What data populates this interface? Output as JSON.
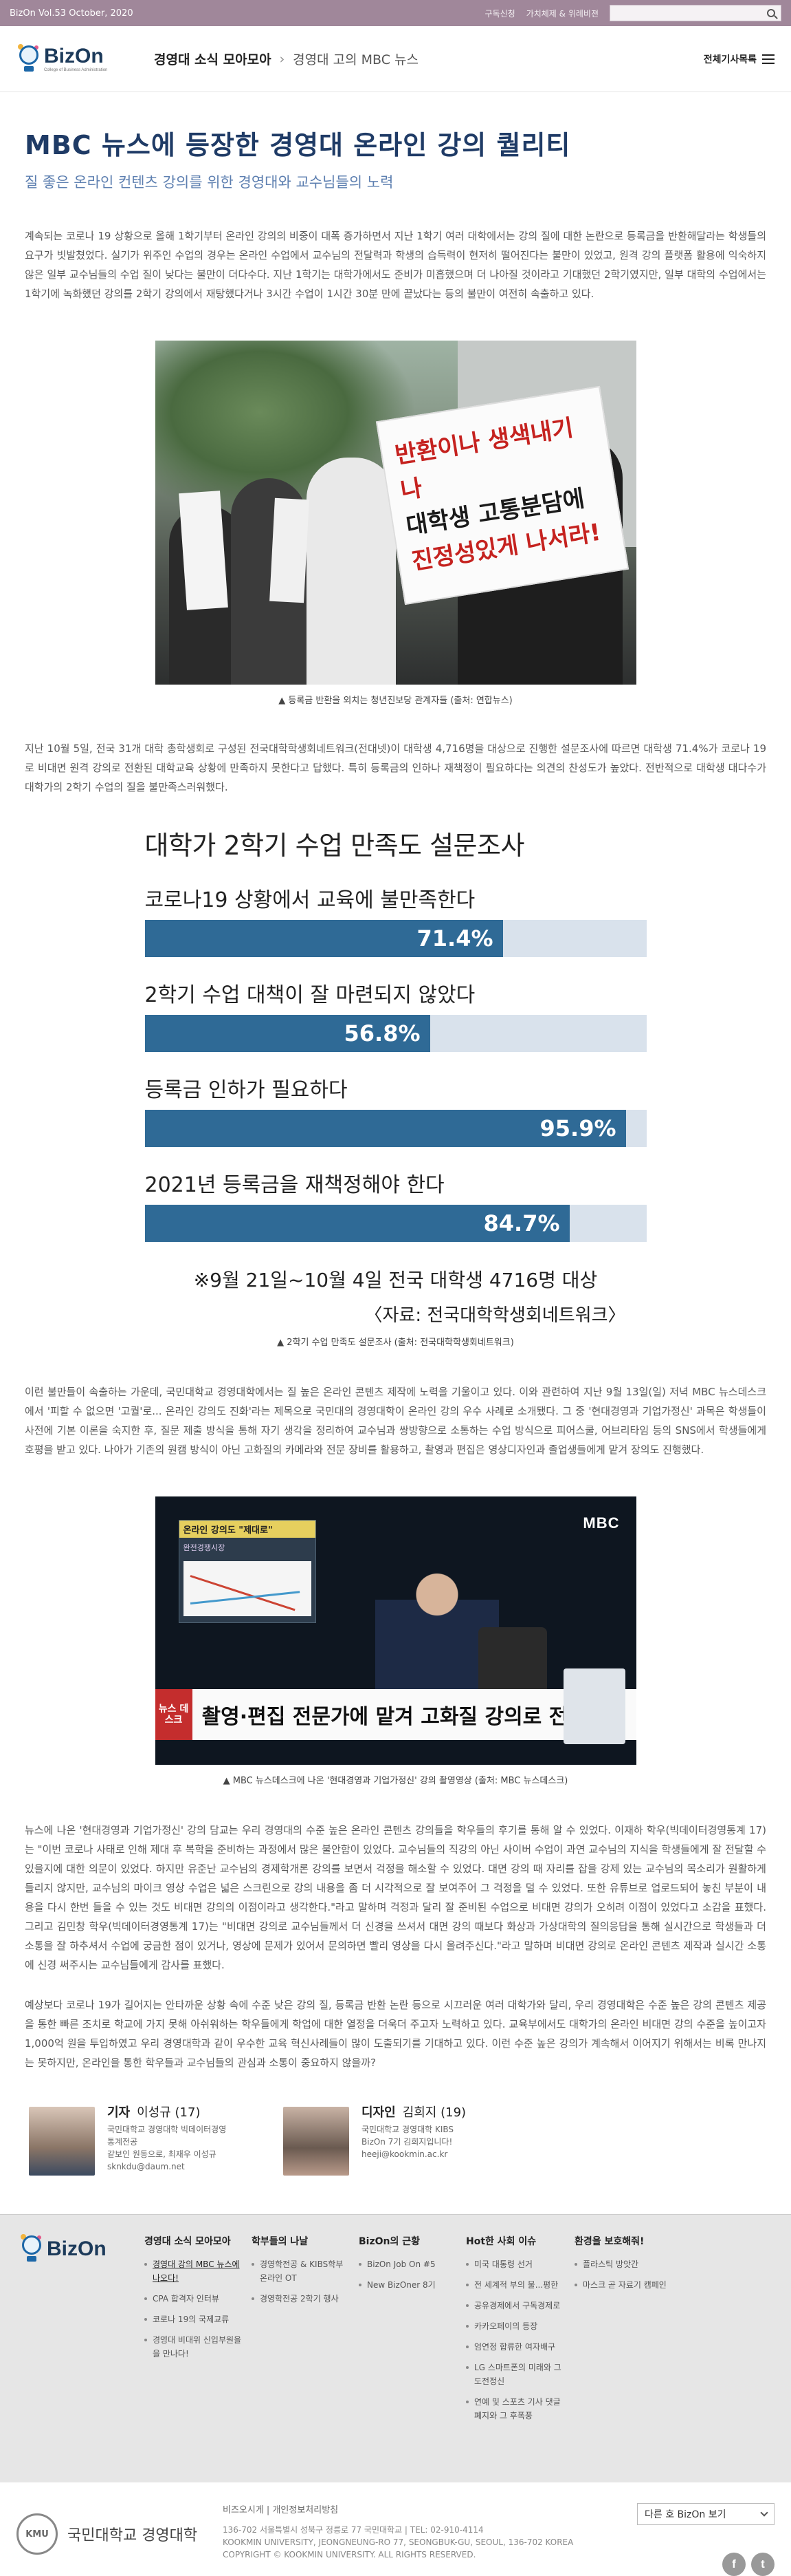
{
  "topbar": {
    "issue": "BizOn Vol.53   October, 2020",
    "links": [
      "구독신청",
      "가치체제 & 위례비젼"
    ]
  },
  "header": {
    "logo": "BizOn",
    "logo_tagline": "College of Business Administration",
    "breadcrumb": {
      "category": "경영대 소식 모아모아",
      "current": "경영대 고의 MBC 뉴스"
    },
    "menu_label": "전체기사목록"
  },
  "article": {
    "title": "MBC 뉴스에 등장한 경영대 온라인 강의 퀄리티",
    "subtitle": "질 좋은 온라인 컨텐츠 강의를 위한 경영대와 교수님들의 노력",
    "p1": "계속되는 코로나 19 상황으로 올해 1학기부터 온라인 강의의 비중이 대폭 증가하면서 지난 1학기 여러 대학에서는 강의 질에 대한 논란으로 등록금을 반환해달라는 학생들의 요구가 빗발쳤었다. 실기가 위주인 수업의 경우는 온라인 수업에서 교수님의 전달력과 학생의 습득력이 현저히 떨어진다는 불만이 있었고, 원격 강의 플랫폼 활용에 익숙하지 않은 일부 교수님들의 수업 질이 낮다는 불만이 더다수다. 지난 1학기는 대학가에서도 준비가 미흡했으며 더 나아질 것이라고 기대했던 2학기였지만, 일부 대학의 수업에서는 1학기에 녹화했던 강의를 2학기 강의에서 재탕했다거나 3시간 수업이 1시간 30분 만에 끝났다는 등의 불만이 여전히 속출하고 있다.",
    "photo_caption": "▲ 등록금 반환을 외치는 청년진보당 관계자들 (출처: 연합뉴스)",
    "sign_text": [
      "반환이나 생색내기나",
      "대학생 고통분담에",
      "진정성있게 나서라!"
    ],
    "p2": "지난 10월 5일, 전국 31개 대학 총학생회로 구성된 전국대학학생회네트워크(전대넷)이 대학생 4,716명을 대상으로 진행한 설문조사에 따르면 대학생 71.4%가 코로나 19로 비대면 원격 강의로 전환된 대학교육 상황에 만족하지 못한다고 답했다. 특히 등록금의 인하나 재책정이 필요하다는 의견의 찬성도가 높았다. 전반적으로 대학생 대다수가 대학가의 2학기 수업의 질을 불만족스러워했다.",
    "survey_caption": "▲ 2학기 수업 만족도 설문조사 (출처: 전국대학학생회네트워크)",
    "p3": "이런 불만들이 속출하는 가운데, 국민대학교 경영대학에서는 질 높은 온라인 콘텐츠 제작에 노력을 기울이고 있다. 이와 관련하여 지난 9월 13일(일) 저녁 MBC 뉴스데스크에서 '피할 수 없으면 '고퀄'로... 온라인 강의도 진화'라는 제목으로 국민대의 경영대학이 온라인 강의 우수 사례로 소개됐다. 그 중 '현대경영과 기업가정신' 과목은 학생들이 사전에 기본 이론을 숙지한 후, 질문 제출 방식을 통해 자기 생각을 정리하여 교수님과 쌍방향으로 소통하는 수업 방식으로 피어스쿨, 어브리타임 등의 SNS에서 학생들에게 호평을 받고 있다. 나아가 기존의 원캠 방식이 아닌 고화질의 카메라와 전문 장비를 활용하고, 촬영과 편집은 영상디자인과 졸업생들에게 맡겨 장의도 진행했다.",
    "video": {
      "channel": "MBC",
      "panel_title": "온라인 강의도 \"제대로\"",
      "panel_sub": "완전경쟁시장",
      "tag": "뉴스 데스크",
      "lower_third": "촬영·편집 전문가에 맡겨 고화질 강의로 전환"
    },
    "video_caption": "▲ MBC 뉴스데스크에 나온 '현대경영과 기업가정신' 강의 촬영영상 (출처: MBC 뉴스데스크)",
    "p4": "뉴스에 나온 '현대경영과 기업가정신' 강의 담교는 우리 경영대의 수준 높은 온라인 콘텐츠 강의들을 학우들의 후기를 통해 알 수 있었다. 이재하 학우(빅데이터경영통계 17)는 \"이번 코로나 사태로 인해 제대 후 복학을 준비하는 과정에서 많은 불안함이 있었다. 교수님들의 직강의 아닌 사이버 수업이 과연 교수님의 지식을 학생들에게 잘 전달할 수 있을지에 대한 의문이 있었다. 하지만 유준난 교수님의 경제학개론 강의를 보면서 걱정을 해소할 수 있었다. 대면 강의 때 자리를 잡을 강제 있는 교수님의 목소리가 원활하게 들리지 않지만, 교수님의 마이크 영상 수업은 넓은 스크린으로 강의 내용을 좀 더 시각적으로 잘 보여주어 그 걱정을 덜 수 있었다. 또한 유튜브로 업로드되어 놓친 부분이 내용을 다시 한번 들을 수 있는 것도 비대면 강의의 이점이라고 생각한다.\"라고 말하며 걱정과 달리 잘 준비된 수업으로 비대면 강의가 오히려 이점이 있었다고 소감을 표했다. 그리고 김민창 학우(빅데이터경영통계 17)는 \"비대면 강의로 교수님들께서 더 신경을 쓰셔서 대면 강의 때보다 화상과 가상대학의 질의응답을 통해 실시간으로 학생들과 더 소통을 잘 하추셔서 수업에 궁금한 점이 있거나, 영상에 문제가 있어서 문의하면 빨리 영상을 다시 올려주신다.\"라고 말하며 비대면 강의로 온라인 콘텐츠 제작과 실시간 소통에 신경 써주시는 교수님들에게 감사를 표했다.",
    "p5": "예상보다 코로나 19가 길어지는 안타까운 상황 속에 수준 낮은 강의 질, 등록금 반환 논란 등으로 시끄러운 여러 대학가와 달리, 우리 경영대학은 수준 높은 강의 콘텐츠 제공을 통한 빠른 조치로 학교에 가지 못해 아쉬워하는 학우들에게 학업에 대한 열정을 더욱더 주고자 노력하고 있다. 교육부에서도 대학가의 온라인 비대면 강의 수준을 높이고자 1,000억 원을 투입하였고 우리 경영대학과 같이 우수한 교육 혁신사례들이 많이 도출되기를 기대하고 있다. 이런 수준 높은 강의가 계속해서 이어지기 위해서는 비록 만나지는 못하지만, 온라인을 통한 학우들과 교수님들의 관심과 소통이 중요하지 않을까?"
  },
  "chart_data": {
    "type": "bar",
    "title": "대학가 2학기 수업 만족도 설문조사",
    "categories": [
      "코로나19 상황에서 교육에 불만족한다",
      "2학기 수업 대책이 잘 마련되지 않았다",
      "등록금 인하가 필요하다",
      "2021년 등록금을 재책정해야 한다"
    ],
    "values": [
      71.4,
      56.8,
      95.9,
      84.7
    ],
    "value_labels": [
      "71.4%",
      "56.8%",
      "95.9%",
      "84.7%"
    ],
    "unit": "%",
    "ylim": [
      0,
      100
    ],
    "note": "※9월 21일~10월 4일 전국 대학생 4716명 대상",
    "source": "〈자료: 전국대학학생회네트워크〉",
    "colors": {
      "fill": "#2f6a96",
      "track": "#d9e2ec"
    }
  },
  "authors": [
    {
      "role": "기자",
      "name": "이성규 (17)",
      "lines": [
        "국민대학교 경영대학 빅데이터경영",
        "통계전공",
        "같보인 원동으로, 최재우 이성규",
        "sknkdu@daum.net"
      ]
    },
    {
      "role": "디자인",
      "name": "김희지 (19)",
      "lines": [
        "국민대학교 경영대학 KIBS",
        "BizOn 7기 김희지입니다!",
        "heeji@kookmin.ac.kr"
      ]
    }
  ],
  "footer_nav": {
    "logo": "BizOn",
    "columns": [
      {
        "title": "경영대 소식 모아모아",
        "items": [
          "경영대 강의 MBC 뉴스에 나오다!",
          "CPA 합격자 인터뷰",
          "코로나 19의 국제교류",
          "경영대 비대위 신입부원을 을 만나다!"
        ],
        "active": 0
      },
      {
        "title": "학부들의 나날",
        "items": [
          "경영학전공 & KIBS학부 온라인 OT",
          "경영학전공 2학기 행사"
        ]
      },
      {
        "title": "BizOn의 근황",
        "items": [
          "BizOn Job On #5",
          "New BizOner 8기"
        ]
      },
      {
        "title": "Hot한 사회 이슈",
        "items": [
          "미국 대통령 선거",
          "전 세계적 부의 불...평한",
          "공유경제에서 구독경제로",
          "카카오페이의 등장",
          "엄연정 합류한 여자배구",
          "LG 스마트폰의 미래와 그 도전정신",
          "연예 및 스포츠 기사 댓글 폐지와 그 후폭풍"
        ]
      },
      {
        "title": "환경을 보호해줘!",
        "items": [
          "플라스틱 방앗간",
          "마스크 곧 자료기 캠페인"
        ]
      }
    ]
  },
  "bottom": {
    "seal": "KMU",
    "school": "국민대학교 경영대학",
    "links": "비즈오시게  |  개인정보처리방침",
    "address": "136-702 서울특별시 성북구 정릉로 77 국민대학교  |  TEL: 02-910-4114",
    "address_en": "KOOKMIN UNIVERSITY, JEONGNEUNG-RO 77, SEONGBUK-GU, SEOUL, 136-702 KOREA",
    "copyright": "COPYRIGHT © KOOKMIN UNIVERSITY. ALL RIGHTS RESERVED.",
    "select_label": "다른 호 BizOn 보기",
    "social": [
      "f",
      "t"
    ]
  }
}
